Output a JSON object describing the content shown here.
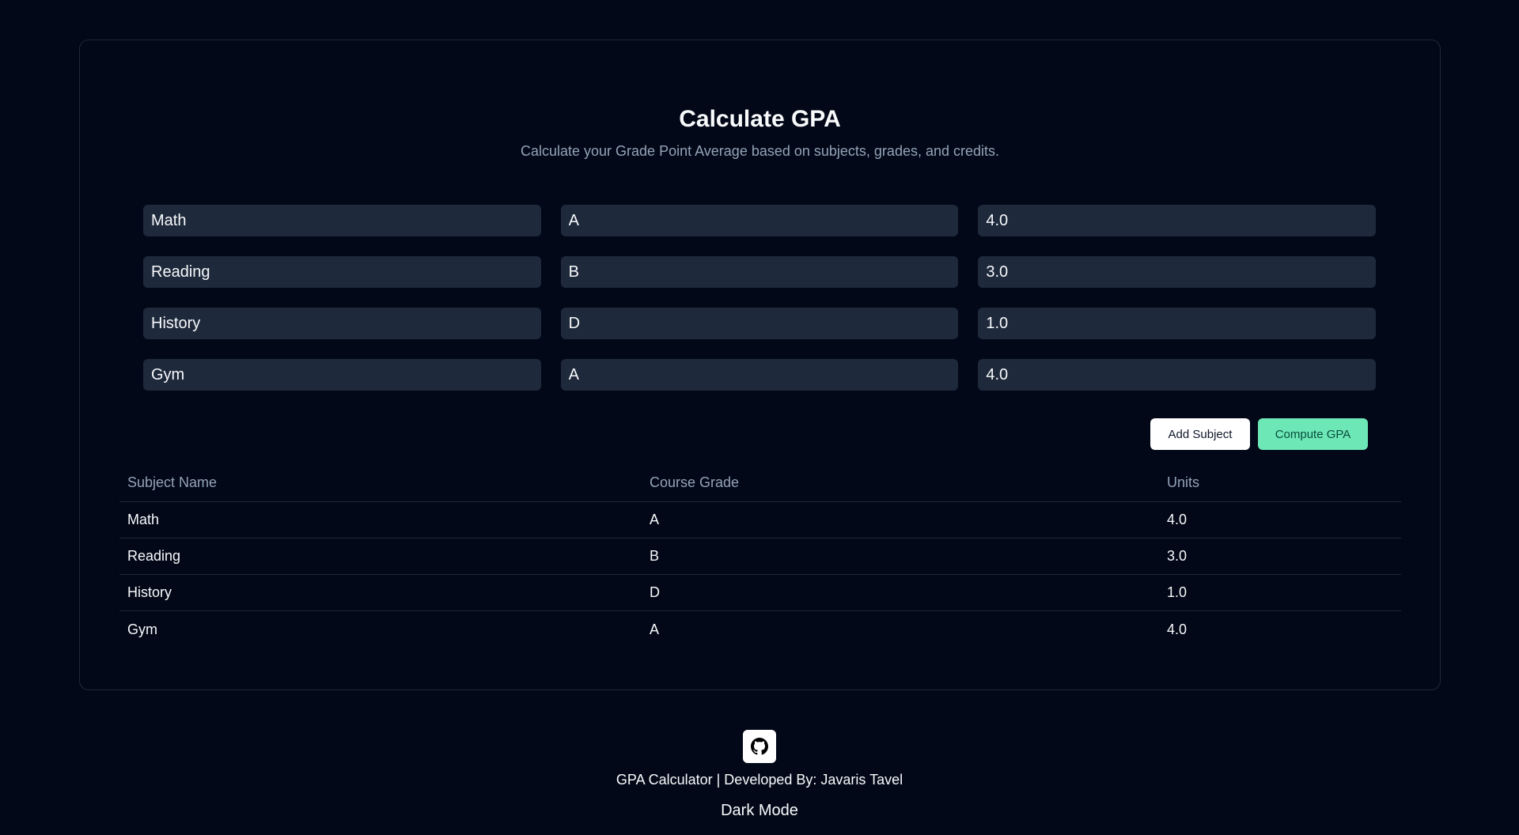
{
  "header": {
    "title": "Calculate GPA",
    "subtitle": "Calculate your Grade Point Average based on subjects, grades, and credits."
  },
  "input_rows": [
    {
      "subject": "Math",
      "grade": "A",
      "units": "4.0"
    },
    {
      "subject": "Reading",
      "grade": "B",
      "units": "3.0"
    },
    {
      "subject": "History",
      "grade": "D",
      "units": "1.0"
    },
    {
      "subject": "Gym",
      "grade": "A",
      "units": "4.0"
    }
  ],
  "actions": {
    "add_label": "Add Subject",
    "compute_label": "Compute GPA"
  },
  "table": {
    "headers": [
      "Subject Name",
      "Course Grade",
      "Units"
    ],
    "rows": [
      [
        "Math",
        "A",
        "4.0"
      ],
      [
        "Reading",
        "B",
        "3.0"
      ],
      [
        "History",
        "D",
        "1.0"
      ],
      [
        "Gym",
        "A",
        "4.0"
      ]
    ]
  },
  "footer": {
    "icon": "github-icon",
    "credit": "GPA Calculator | Developed By: Javaris Tavel",
    "theme_toggle": "Dark Mode"
  },
  "colors": {
    "background": "#020817",
    "field": "#1e293b",
    "accent_green": "#6ee7b7",
    "muted_text": "#94a3b8"
  }
}
